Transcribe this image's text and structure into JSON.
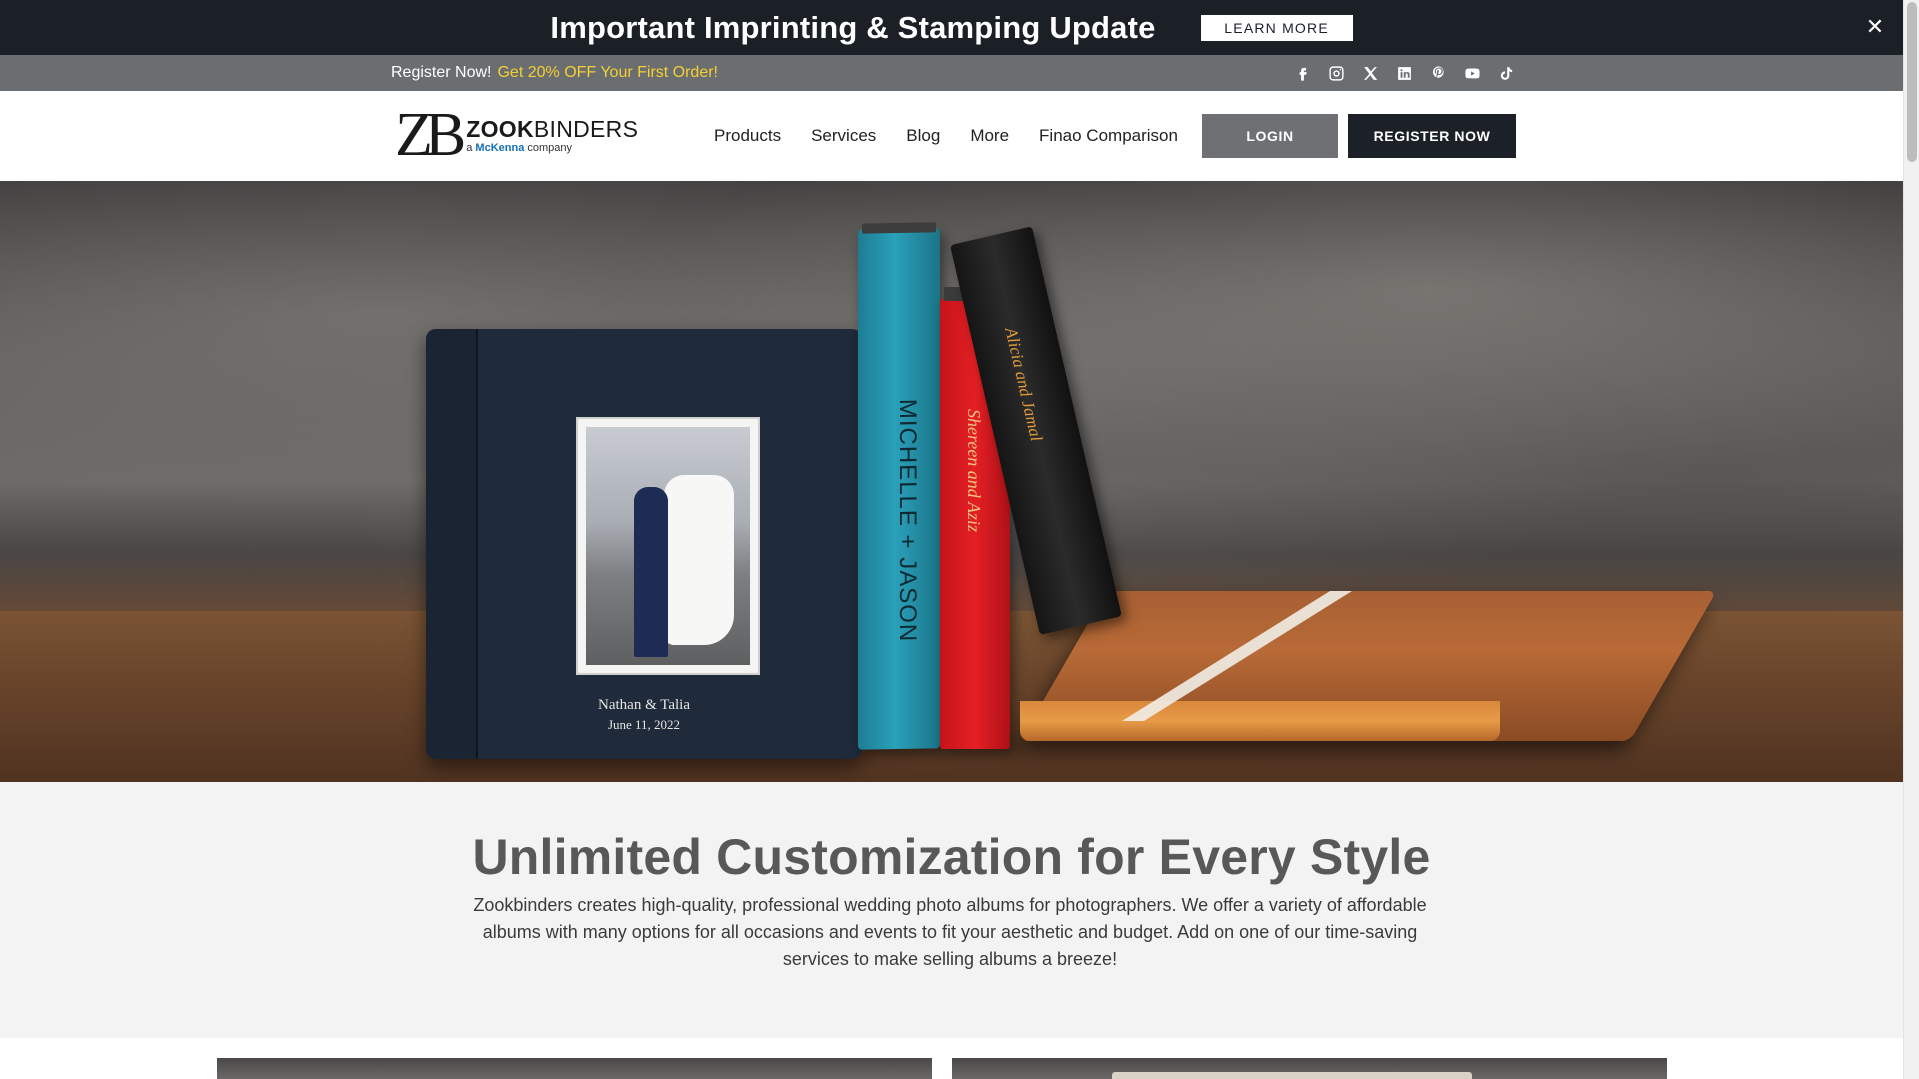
{
  "announcement": {
    "title": "Important Imprinting & Stamping Update",
    "button_label": "LEARN MORE",
    "close_glyph": "✕"
  },
  "promo": {
    "lead": "Register Now!",
    "offer": "Get 20% OFF Your First Order!",
    "offer_color": "#f5d033",
    "social_icons": [
      "facebook-icon",
      "instagram-icon",
      "x-icon",
      "linkedin-icon",
      "pinterest-icon",
      "youtube-icon",
      "tiktok-icon"
    ]
  },
  "header": {
    "logo": {
      "mark": "ZB",
      "name_bold": "ZOOK",
      "name_rest": "BINDERS",
      "sub_prefix": "a ",
      "sub_brand": "McKenna",
      "sub_suffix": " company"
    },
    "nav": [
      "Products",
      "Services",
      "Blog",
      "More",
      "Finao Comparison"
    ],
    "login_label": "LOGIN",
    "register_label": "REGISTER NOW"
  },
  "hero": {
    "album_names": "Nathan & Talia",
    "album_date": "June 11, 2022",
    "teal_book_text": "MICHELLE + JASON",
    "red_book_text": "Shereen and Aziz",
    "black_book_text": "Alicia and Jamal"
  },
  "intro": {
    "title": "Unlimited Customization for Every Style",
    "body": "Zookbinders creates high-quality, professional wedding photo albums for photographers. We offer a variety of affordable albums with many options for all occasions and events to fit your aesthetic and budget. Add on one of our time-saving services to make selling albums a breeze!"
  },
  "colors": {
    "announce_bg": "#1b2027",
    "promo_bg": "#6b6e71",
    "login_bg": "#6e7073",
    "register_bg": "#1c2128",
    "intro_bg": "#f3f3f3"
  }
}
